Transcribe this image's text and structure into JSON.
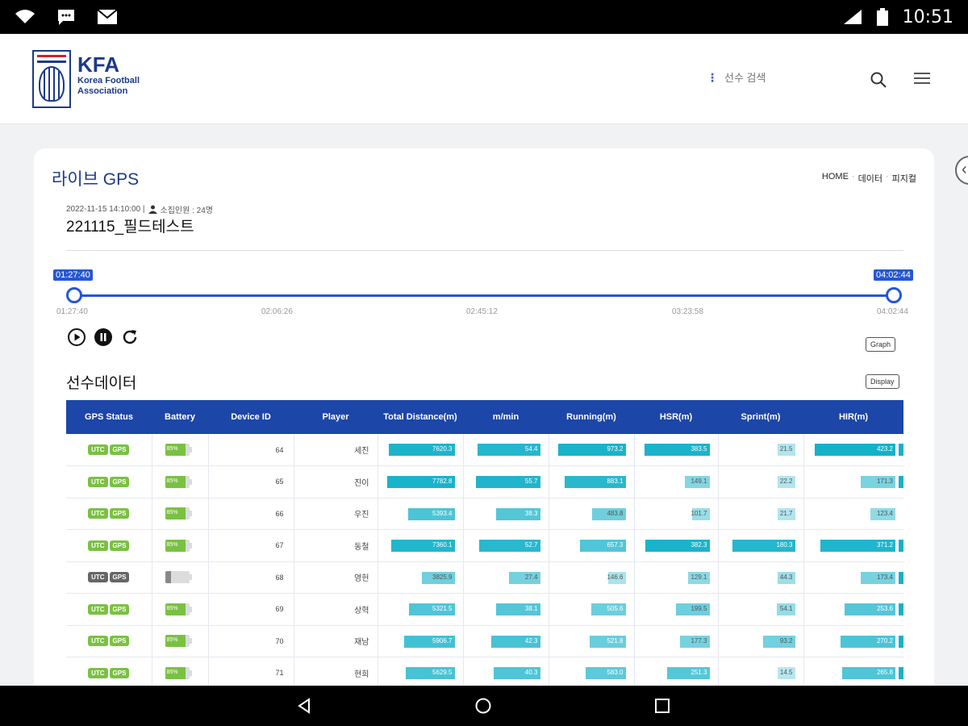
{
  "status_bar": {
    "time": "10:51"
  },
  "header": {
    "logo_title": "KFA",
    "logo_sub1": "Korea Football",
    "logo_sub2": "Association",
    "search_placeholder": "선수 검색"
  },
  "page": {
    "title": "라이브 GPS",
    "breadcrumb": [
      "HOME",
      "데이터",
      "피지컬"
    ],
    "meta_datetime": "2022-11-15 14:10:00 |",
    "meta_attendance": "소집인원 : 24명",
    "session_title": "221115_필드테스트",
    "section_title": "선수데이터",
    "graph_btn": "Graph",
    "display_btn": "Display"
  },
  "timeline": {
    "start_label": "01:27:40",
    "end_label": "04:02:44",
    "ticks": [
      "01:27:40",
      "02:06:26",
      "02:45:12",
      "03:23:58",
      "04:02:44"
    ]
  },
  "table": {
    "headers": [
      "GPS Status",
      "Battery",
      "Device ID",
      "Player",
      "Total Distance(m)",
      "m/min",
      "Running(m)",
      "HSR(m)",
      "Sprint(m)",
      "HIR(m)"
    ],
    "status_labels": [
      "UTC",
      "GPS"
    ],
    "max": {
      "total": 8000,
      "mmin": 60,
      "running": 1000,
      "hsr": 400,
      "sprint": 200,
      "hir": 400
    },
    "rows": [
      {
        "active": true,
        "battery": "85%",
        "battery_level": 0.85,
        "device": "64",
        "player": "세진",
        "total": "7620.3",
        "mmin": "54.4",
        "running": "973.2",
        "hsr": "383.5",
        "sprint": "21.5",
        "hir": "423.2"
      },
      {
        "active": true,
        "battery": "85%",
        "battery_level": 0.85,
        "device": "65",
        "player": "진이",
        "total": "7782.8",
        "mmin": "55.7",
        "running": "883.1",
        "hsr": "149.1",
        "sprint": "22.2",
        "hir": "171.3"
      },
      {
        "active": true,
        "battery": "85%",
        "battery_level": 0.85,
        "device": "66",
        "player": "우진",
        "total": "5393.4",
        "mmin": "38.3",
        "running": "483.8",
        "hsr": "101.7",
        "sprint": "21.7",
        "hir": "123.4"
      },
      {
        "active": true,
        "battery": "85%",
        "battery_level": 0.85,
        "device": "67",
        "player": "동철",
        "total": "7360.1",
        "mmin": "52.7",
        "running": "657.3",
        "hsr": "382.3",
        "sprint": "180.3",
        "hir": "371.2"
      },
      {
        "active": false,
        "battery": "",
        "battery_level": 0.25,
        "device": "68",
        "player": "영헌",
        "total": "3825.9",
        "mmin": "27.4",
        "running": "146.6",
        "hsr": "129.1",
        "sprint": "44.3",
        "hir": "173.4"
      },
      {
        "active": true,
        "battery": "85%",
        "battery_level": 0.85,
        "device": "69",
        "player": "상혁",
        "total": "5321.5",
        "mmin": "38.1",
        "running": "505.6",
        "hsr": "199.5",
        "sprint": "54.1",
        "hir": "253.6"
      },
      {
        "active": true,
        "battery": "85%",
        "battery_level": 0.85,
        "device": "70",
        "player": "재남",
        "total": "5906.7",
        "mmin": "42.3",
        "running": "521.8",
        "hsr": "177.3",
        "sprint": "93.2",
        "hir": "270.2"
      },
      {
        "active": true,
        "battery": "85%",
        "battery_level": 0.85,
        "device": "71",
        "player": "현희",
        "total": "5629.5",
        "mmin": "40.3",
        "running": "583.0",
        "hsr": "251.3",
        "sprint": "14.5",
        "hir": "265.8"
      }
    ]
  },
  "colors": {
    "brand_blue": "#1b3a8a",
    "accent_blue": "#2457d6",
    "table_header": "#1c46a8",
    "status_green": "#7ac142",
    "bar_teal": "#14b1c9"
  }
}
